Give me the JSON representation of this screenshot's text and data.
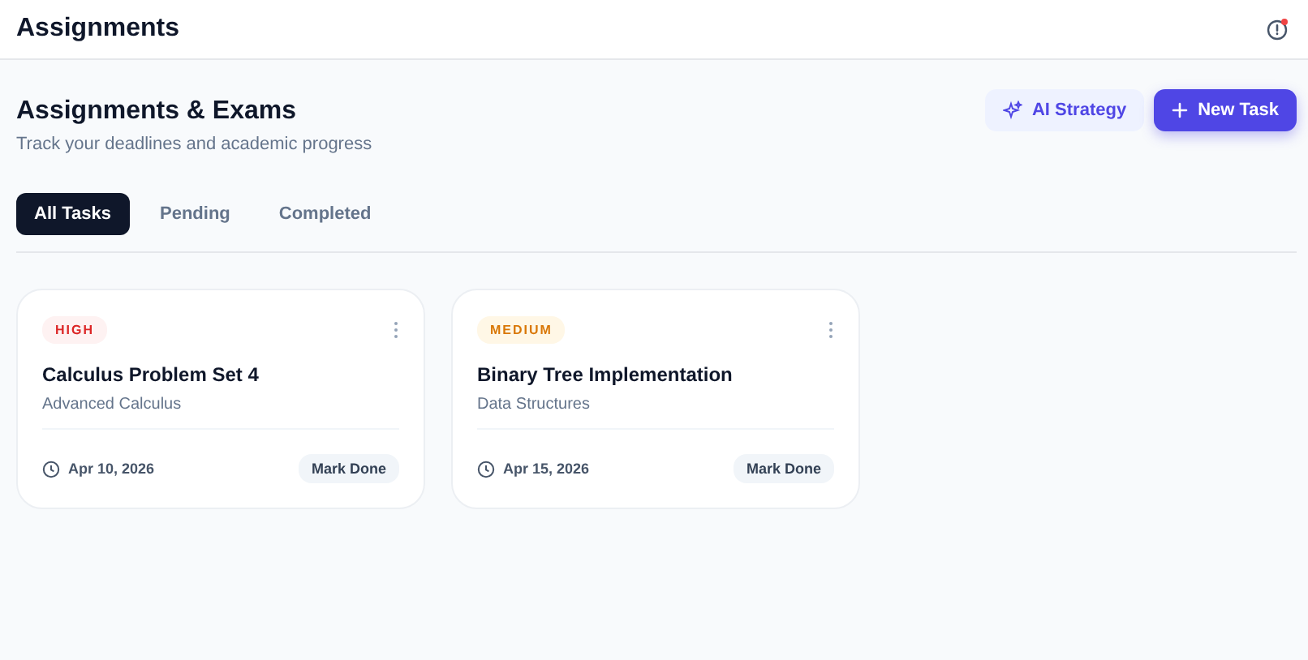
{
  "header": {
    "title": "Assignments",
    "alert": true
  },
  "page": {
    "title": "Assignments & Exams",
    "subtitle": "Track your deadlines and academic progress"
  },
  "actions": [
    {
      "label": "AI Strategy",
      "kind": "secondary"
    },
    {
      "label": "New Task",
      "kind": "primary"
    }
  ],
  "tabs": [
    {
      "label": "All Tasks",
      "selected": true
    },
    {
      "label": "Pending",
      "selected": false
    },
    {
      "label": "Completed",
      "selected": false
    }
  ],
  "tasks": [
    {
      "priority": "HIGH",
      "kind": "high",
      "title": "Calculus Problem Set 4",
      "course": "Advanced Calculus",
      "due": "Apr 10, 2026",
      "action": "Mark Done"
    },
    {
      "priority": "MEDIUM",
      "kind": "medium",
      "title": "Binary Tree Implementation",
      "course": "Data Structures",
      "due": "Apr 15, 2026",
      "action": "Mark Done"
    }
  ]
}
